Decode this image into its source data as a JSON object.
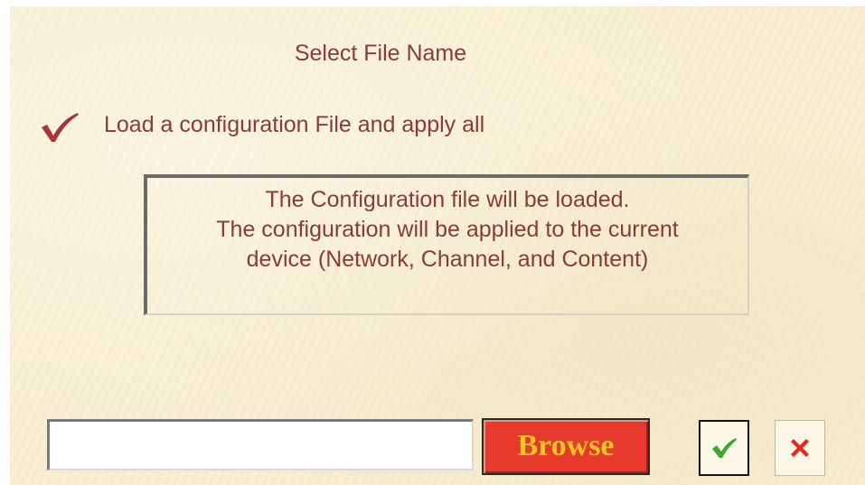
{
  "dialog": {
    "title": "Select File Name",
    "option": {
      "label": "Load a configuration File and apply all",
      "checked": true,
      "icon": "checkmark-icon"
    },
    "info_lines": [
      "The Configuration file will be loaded.",
      "The configuration will be applied to the current",
      "device (Network, Channel, and Content)"
    ],
    "file_input": {
      "value": "",
      "placeholder": ""
    },
    "browse_label": "Browse",
    "ok_icon": "green-check-icon",
    "cancel_icon": "red-x-icon"
  },
  "colors": {
    "background": "#f8efd2",
    "text": "#8b3a3a",
    "browse_bg": "#e53a2c",
    "browse_text": "#f6c324",
    "ok_icon": "#3aa832",
    "cancel_icon": "#e52a1e"
  }
}
